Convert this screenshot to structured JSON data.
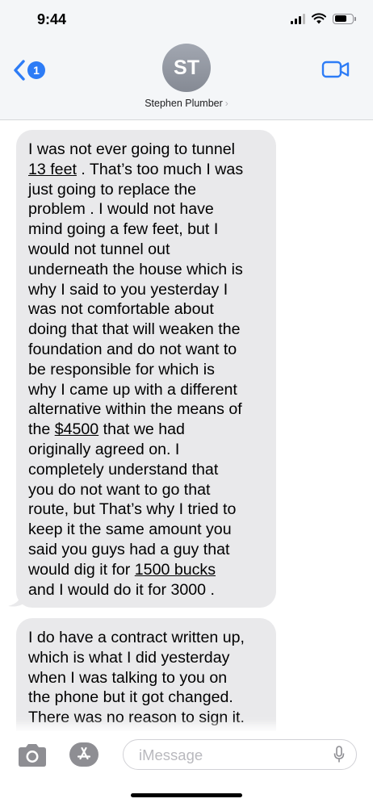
{
  "status_bar": {
    "time": "9:44"
  },
  "header": {
    "back_badge_count": "1",
    "avatar_initials": "ST",
    "contact_name": "Stephen Plumber",
    "contact_chevron": "›",
    "accent_color": "#2d7cf6"
  },
  "messages": [
    {
      "sender": "Stephen Plumber",
      "lines": [
        "I was not ever going to tunnel",
        "13 feet",
        " . That’s too much I was",
        "just going to replace the",
        "problem . I would not have",
        "mind going a few feet, but I",
        "would not tunnel out",
        "underneath the house which is",
        "why I said to you yesterday I",
        "was not comfortable about",
        "doing that that will weaken the",
        "foundation and do not want to",
        "be responsible for which is",
        "why I came up with a different",
        "alternative within the means of",
        "the ",
        "$4500",
        " that we had",
        "originally agreed on. I",
        "completely understand that",
        "you do not want to go that",
        "route, but That’s why I tried to",
        "keep it the same amount you",
        "said you guys had a guy that",
        "would dig it for ",
        "1500 bucks",
        "and I would do it for 3000 ."
      ]
    },
    {
      "sender": "Stephen Plumber",
      "lines": [
        "I do have a contract written up,",
        "which is what I did yesterday",
        "when I was talking to you on",
        "the phone but it got changed.",
        "There was no reason to sign it."
      ]
    }
  ],
  "compose": {
    "placeholder": "iMessage"
  },
  "icons": {
    "back": "chevron-left-icon",
    "facetime": "video-camera-icon",
    "camera": "camera-icon",
    "app_store": "app-store-icon",
    "mic": "microphone-icon"
  }
}
